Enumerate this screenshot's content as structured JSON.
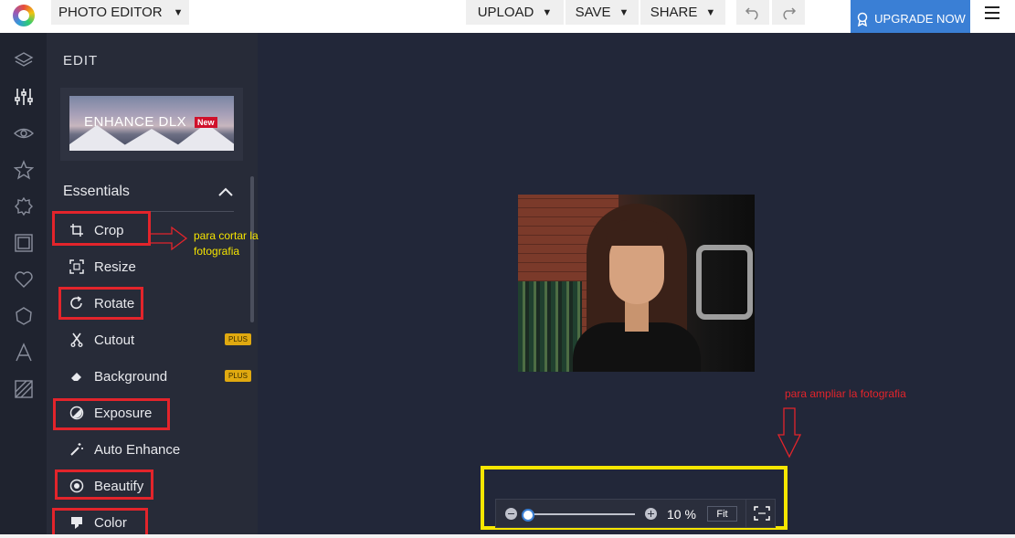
{
  "header": {
    "app_menu_label": "PHOTO EDITOR",
    "upload_label": "UPLOAD",
    "save_label": "SAVE",
    "share_label": "SHARE",
    "upgrade_label": "UPGRADE NOW"
  },
  "rail": {
    "icons": [
      "layers-icon",
      "sliders-icon",
      "eye-icon",
      "star-icon",
      "badge-icon",
      "frame-icon",
      "heart-icon",
      "sticker-icon",
      "text-icon",
      "texture-icon"
    ]
  },
  "panel": {
    "title": "EDIT",
    "banner_text": "ENHANCE DLX",
    "banner_badge": "New",
    "section_title": "Essentials",
    "items": [
      {
        "label": "Crop",
        "icon": "crop-icon"
      },
      {
        "label": "Resize",
        "icon": "resize-icon"
      },
      {
        "label": "Rotate",
        "icon": "rotate-icon"
      },
      {
        "label": "Cutout",
        "icon": "scissors-icon",
        "badge": "PLUS"
      },
      {
        "label": "Background",
        "icon": "eraser-icon",
        "badge": "PLUS"
      },
      {
        "label": "Exposure",
        "icon": "exposure-icon"
      },
      {
        "label": "Auto Enhance",
        "icon": "magic-wand-icon"
      },
      {
        "label": "Beautify",
        "icon": "beautify-icon"
      },
      {
        "label": "Color",
        "icon": "color-icon"
      }
    ]
  },
  "annotations": {
    "crop_note": "para cortar la fotografia",
    "zoom_note": "para ampliar la fotografia",
    "crop_note_color": "#f5e400",
    "zoom_note_color": "#e3242b"
  },
  "zoom": {
    "level_label": "10 %",
    "level_value": 0.1,
    "fit_label": "Fit"
  },
  "colors": {
    "accent": "#3a7fd5",
    "plus_badge": "#e0a910",
    "highlight_red": "#e3242b",
    "highlight_yellow": "#f6e600"
  }
}
